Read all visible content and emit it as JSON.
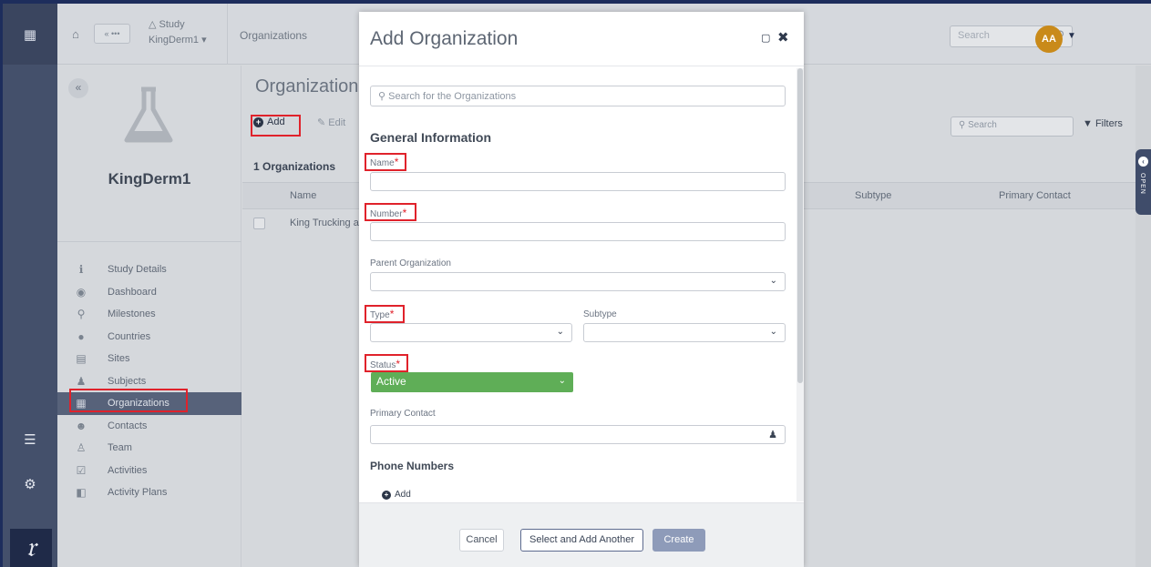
{
  "topbar": {
    "study_label": "Study",
    "study_name": "KingDerm1",
    "back_label": "« •••",
    "breadcrumb": "Organizations",
    "search_placeholder": "Search",
    "avatar_initials": "AA"
  },
  "study_panel": {
    "collapse": "«",
    "study_name": "KingDerm1",
    "nav": [
      {
        "label": "Study Details",
        "icon": "info-icon"
      },
      {
        "label": "Dashboard",
        "icon": "dashboard-icon"
      },
      {
        "label": "Milestones",
        "icon": "map-pin-icon"
      },
      {
        "label": "Countries",
        "icon": "globe-icon"
      },
      {
        "label": "Sites",
        "icon": "clipboard-icon"
      },
      {
        "label": "Subjects",
        "icon": "person-icon"
      },
      {
        "label": "Organizations",
        "icon": "building-icon",
        "active": true
      },
      {
        "label": "Contacts",
        "icon": "contacts-icon"
      },
      {
        "label": "Team",
        "icon": "team-icon"
      },
      {
        "label": "Activities",
        "icon": "calendar-check-icon"
      },
      {
        "label": "Activity Plans",
        "icon": "plan-icon"
      }
    ]
  },
  "main": {
    "title": "Organization",
    "add_label": "Add",
    "edit_label": "Edit",
    "search_placeholder": "Search",
    "filters_label": "Filters",
    "count_label": "1 Organizations",
    "columns": {
      "name": "Name",
      "subtype": "Subtype",
      "primary_contact": "Primary Contact"
    },
    "rows": [
      {
        "name": "King Trucking an"
      }
    ],
    "open_tab_label": "OPEN"
  },
  "modal": {
    "title": "Add Organization",
    "search_placeholder": "Search for the Organizations",
    "section_general": "General Information",
    "name_label": "Name",
    "number_label": "Number",
    "parent_label": "Parent Organization",
    "type_label": "Type",
    "subtype_label": "Subtype",
    "status_label": "Status",
    "status_value": "Active",
    "primary_contact_label": "Primary Contact",
    "required_mark": "*",
    "section_phones": "Phone Numbers",
    "phone_add_label": "Add",
    "cancel_label": "Cancel",
    "another_label": "Select and Add Another",
    "create_label": "Create"
  },
  "colors": {
    "accent_navy": "#1d2d5c",
    "status_green": "#5fae57",
    "highlight_red": "#e0222b",
    "avatar": "#c98a1a"
  }
}
